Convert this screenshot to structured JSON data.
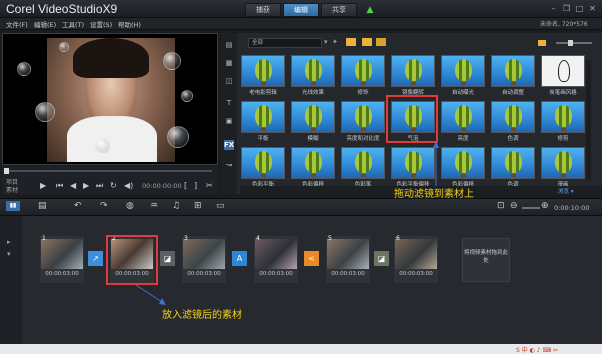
{
  "app": {
    "logo_text": "Corel VideoStudioX9"
  },
  "tabs": [
    {
      "label": "捕获"
    },
    {
      "label": "编辑"
    },
    {
      "label": "共享"
    }
  ],
  "menu": [
    "文件(F)",
    "编辑(E)",
    "工具(T)",
    "设置(S)",
    "帮助(H)"
  ],
  "file_info": "未命名, 720*576",
  "player": {
    "mode_top": "项目",
    "mode_bottom": "素材",
    "timecode": "00:00:00:00"
  },
  "library": {
    "gallery_value": "全部",
    "select_label": "浏览 ▾",
    "filters": [
      {
        "label": "老电影剪辑",
        "style": "balloon"
      },
      {
        "label": "光线效果",
        "style": "balloon"
      },
      {
        "label": "修饰",
        "style": "balloon"
      },
      {
        "label": "镜像翻转",
        "style": "balloon"
      },
      {
        "label": "自动曝光",
        "style": "balloon"
      },
      {
        "label": "自动调整",
        "style": "balloon"
      },
      {
        "label": "炭笔画风格",
        "style": "white"
      },
      {
        "label": "平衡",
        "style": "balloon"
      },
      {
        "label": "模糊",
        "style": "balloon"
      },
      {
        "label": "亮度和对比度",
        "style": "balloon"
      },
      {
        "label": "气泡",
        "style": "balloon"
      },
      {
        "label": "亮度",
        "style": "balloon"
      },
      {
        "label": "色调",
        "style": "balloon"
      },
      {
        "label": "修剪",
        "style": "balloon"
      },
      {
        "label": "色彩平衡",
        "style": "balloon"
      },
      {
        "label": "色彩偏移",
        "style": "balloon"
      },
      {
        "label": "色彩笔",
        "style": "balloon"
      },
      {
        "label": "色彩平衡偏移",
        "style": "balloon"
      },
      {
        "label": "色彩偏移",
        "style": "balloon"
      },
      {
        "label": "色调",
        "style": "balloon"
      },
      {
        "label": "漫画",
        "style": "balloon"
      }
    ]
  },
  "annotations": {
    "drag_filter": "拖动滤镜到素材上",
    "applied_clip": "放入滤镜后的素材"
  },
  "timeline": {
    "timecode": "0:00:10:00",
    "clips": [
      {
        "num": "1",
        "time": "00:00:03:00"
      },
      {
        "num": "2",
        "time": "00:00:03:00"
      },
      {
        "num": "3",
        "time": "00:00:03:00"
      },
      {
        "num": "4",
        "time": "00:00:03:00"
      },
      {
        "num": "5",
        "time": "00:00:03:00"
      },
      {
        "num": "6",
        "time": "00:00:03:00"
      }
    ],
    "dropzone_text": "将视频素材拖到此处"
  },
  "colors": {
    "accent": "#2b6aa3",
    "annotation": "#f2d21b",
    "highlight": "#e03a3a"
  }
}
